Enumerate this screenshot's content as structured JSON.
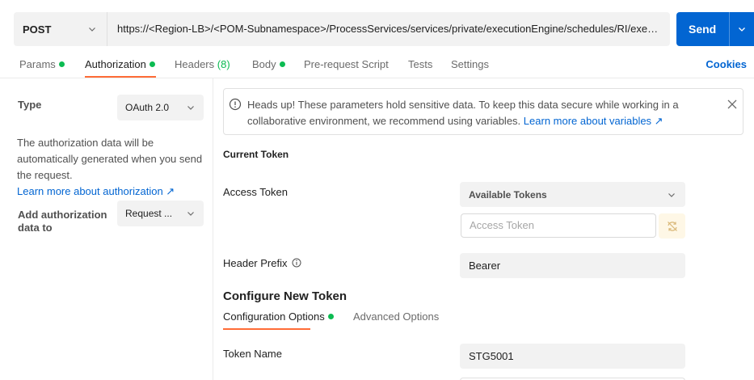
{
  "request": {
    "method": "POST",
    "url": "https://<Region-LB>/<POM-Subnamespace>/ProcessServices/services/private/executionEngine/schedules/RI/execut ...",
    "send_label": "Send"
  },
  "tabs": [
    {
      "label": "Params",
      "dot": true
    },
    {
      "label": "Authorization",
      "dot": true
    },
    {
      "label": "Headers",
      "count": "(8)"
    },
    {
      "label": "Body",
      "dot": true
    },
    {
      "label": "Pre-request Script"
    },
    {
      "label": "Tests"
    },
    {
      "label": "Settings"
    }
  ],
  "cookies_label": "Cookies",
  "left": {
    "type_label": "Type",
    "type_value": "OAuth 2.0",
    "description": "The authorization data will be automatically generated when you send the request.",
    "learn_more": "Learn more about authorization ↗",
    "add_to_label": "Add authorization data to",
    "add_to_value": "Request ..."
  },
  "notice": {
    "text": "Heads up! These parameters hold sensitive data. To keep this data secure while working in a collaborative environment, we recommend using variables.",
    "link": "Learn more about variables ↗"
  },
  "current_token": {
    "heading": "Current Token",
    "access_token_label": "Access Token",
    "available_tokens": "Available Tokens",
    "access_token_placeholder": "Access Token",
    "header_prefix_label": "Header Prefix",
    "header_prefix_value": "Bearer"
  },
  "configure": {
    "title": "Configure New Token",
    "tabs": [
      {
        "label": "Configuration Options",
        "dot": true
      },
      {
        "label": "Advanced Options"
      }
    ],
    "token_name_label": "Token Name",
    "token_name_value": "STG5001"
  },
  "colors": {
    "accent": "#ff6c37",
    "primary": "#0265d2",
    "success": "#0cbb52"
  }
}
